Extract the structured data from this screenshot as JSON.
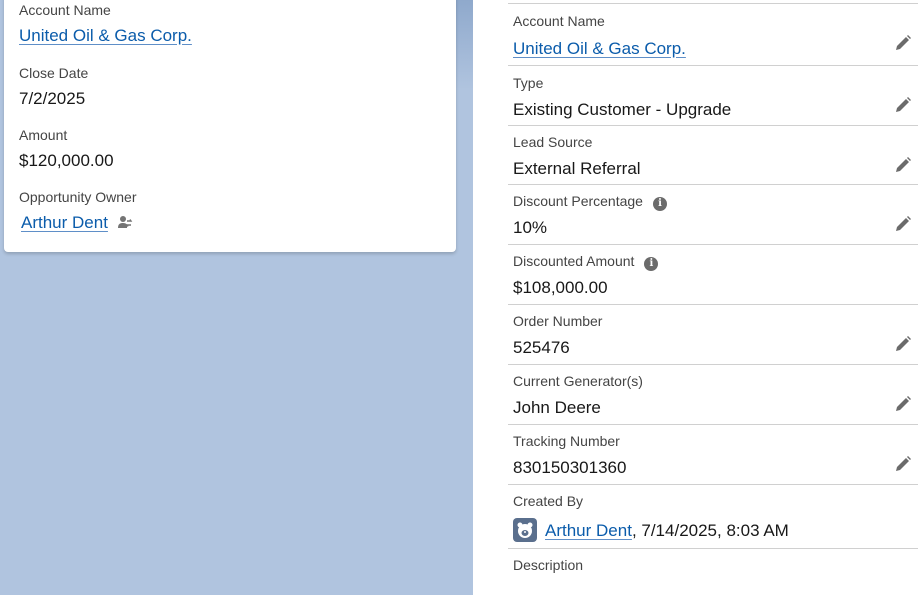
{
  "summary": {
    "account_name_label": "Account Name",
    "account_name_value": "United Oil & Gas Corp.",
    "close_date_label": "Close Date",
    "close_date_value": "7/2/2025",
    "amount_label": "Amount",
    "amount_value": "$120,000.00",
    "owner_label": "Opportunity Owner",
    "owner_value": "Arthur Dent",
    "owner_icon": "change-owner-icon"
  },
  "details": {
    "account_name": {
      "label": "Account Name",
      "value": "United Oil & Gas Corp."
    },
    "type": {
      "label": "Type",
      "value": "Existing Customer - Upgrade"
    },
    "lead_source": {
      "label": "Lead Source",
      "value": "External Referral"
    },
    "discount_percentage": {
      "label": "Discount Percentage",
      "value": "10%"
    },
    "discounted_amount": {
      "label": "Discounted Amount",
      "value": "$108,000.00"
    },
    "order_number": {
      "label": "Order Number",
      "value": "525476"
    },
    "current_generators": {
      "label": "Current Generator(s)",
      "value": "John Deere"
    },
    "tracking_number": {
      "label": "Tracking Number",
      "value": "830150301360"
    },
    "created_by": {
      "label": "Created By",
      "user": "Arthur Dent",
      "timestamp": ", 7/14/2025, 8:03 AM"
    },
    "description": {
      "label": "Description"
    }
  },
  "icons": {
    "edit": "pencil-icon",
    "info": "info-icon",
    "avatar": "user-avatar-icon"
  },
  "colors": {
    "link": "#0b5cab",
    "background": "#b0c4df"
  }
}
